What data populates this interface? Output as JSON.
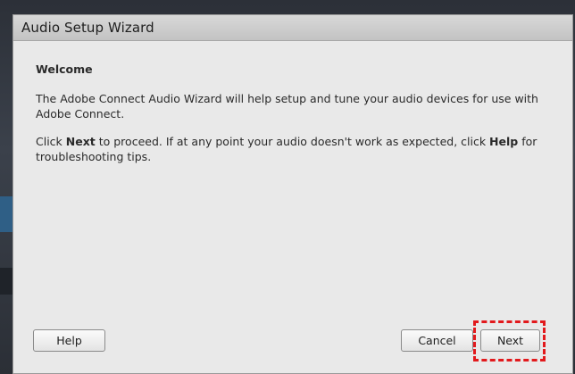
{
  "dialog": {
    "title": "Audio Setup Wizard",
    "heading": "Welcome",
    "intro": "The Adobe Connect Audio Wizard will help setup and tune your audio devices for use with Adobe Connect.",
    "instruction": {
      "part1": "Click ",
      "next_word": "Next",
      "part2": " to proceed. If at any point your audio doesn't work as expected, click ",
      "help_word": "Help",
      "part3": " for troubleshooting tips."
    }
  },
  "buttons": {
    "help": "Help",
    "cancel": "Cancel",
    "next": "Next"
  },
  "colors": {
    "highlight": "#e2191c"
  }
}
